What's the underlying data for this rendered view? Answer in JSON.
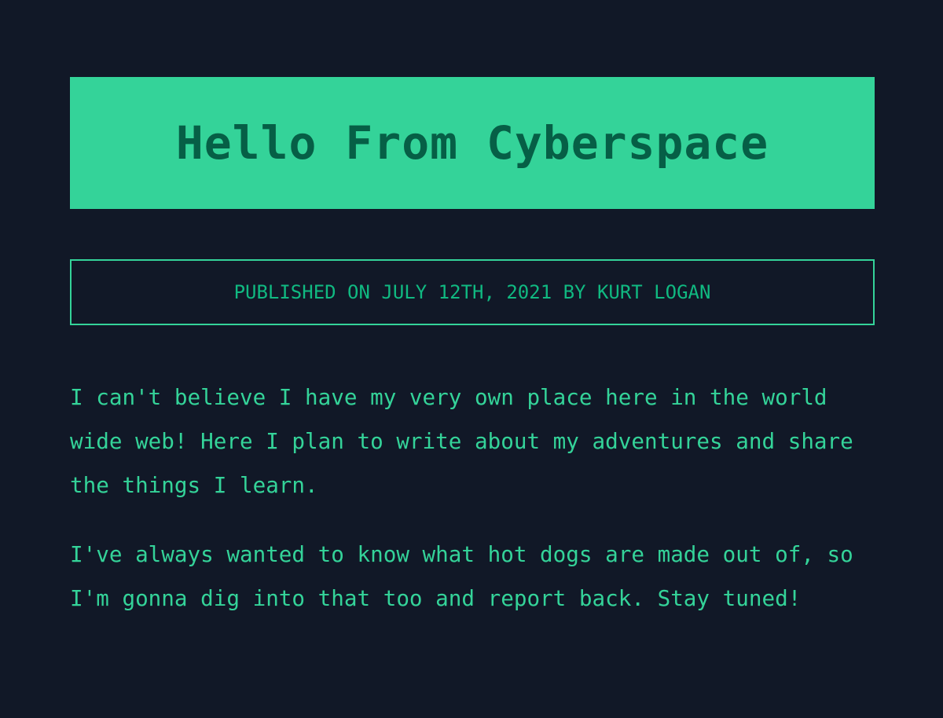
{
  "header": {
    "title": "Hello From Cyberspace"
  },
  "meta": {
    "byline": "PUBLISHED ON JULY 12TH, 2021 BY KURT LOGAN"
  },
  "article": {
    "paragraphs": [
      "I can't believe I have my very own place here in the world wide web! Here I plan to write about my adventures and share the things I learn.",
      "I've always wanted to know what hot dogs are made out of, so I'm gonna dig into that too and report back. Stay tuned!"
    ]
  },
  "colors": {
    "background": "#111827",
    "accent": "#34d399",
    "title_text": "#065f46",
    "byline_text": "#10b981"
  }
}
